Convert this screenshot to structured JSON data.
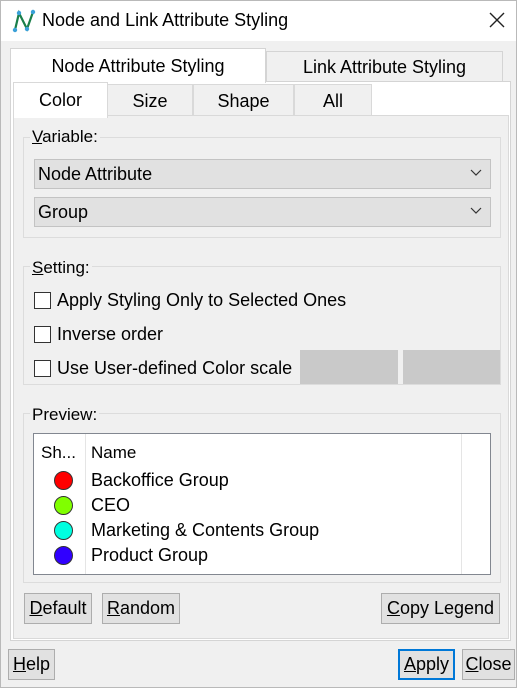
{
  "window": {
    "title": "Node and Link Attribute Styling"
  },
  "outer_tabs": [
    {
      "label": "Node Attribute Styling"
    },
    {
      "label": "Link Attribute Styling"
    }
  ],
  "inner_tabs": [
    {
      "label": "Color"
    },
    {
      "label": "Size"
    },
    {
      "label": "Shape"
    },
    {
      "label": "All"
    }
  ],
  "variable": {
    "group_label": "Variable:",
    "attribute_type": "Node Attribute",
    "attribute": "Group"
  },
  "setting": {
    "group_label": "Setting:",
    "options": [
      {
        "label": "Apply Styling Only to Selected Ones",
        "checked": false
      },
      {
        "label": "Inverse order",
        "checked": false
      },
      {
        "label": "Use User-defined Color scale",
        "checked": false
      }
    ],
    "scale_colors": [
      "#c9c9c9",
      "#c9c9c9"
    ]
  },
  "preview": {
    "group_label": "Preview:",
    "columns": [
      "Sh...",
      "Name"
    ],
    "rows": [
      {
        "name": "Backoffice Group",
        "color": "#ff0000"
      },
      {
        "name": "CEO",
        "color": "#80ff00"
      },
      {
        "name": "Marketing & Contents Group",
        "color": "#00ffe0"
      },
      {
        "name": "Product Group",
        "color": "#3000ff"
      }
    ]
  },
  "buttons": {
    "default": "Default",
    "random": "Random",
    "copy_legend": "Copy Legend",
    "help": "Help",
    "apply": "Apply",
    "close": "Close"
  }
}
